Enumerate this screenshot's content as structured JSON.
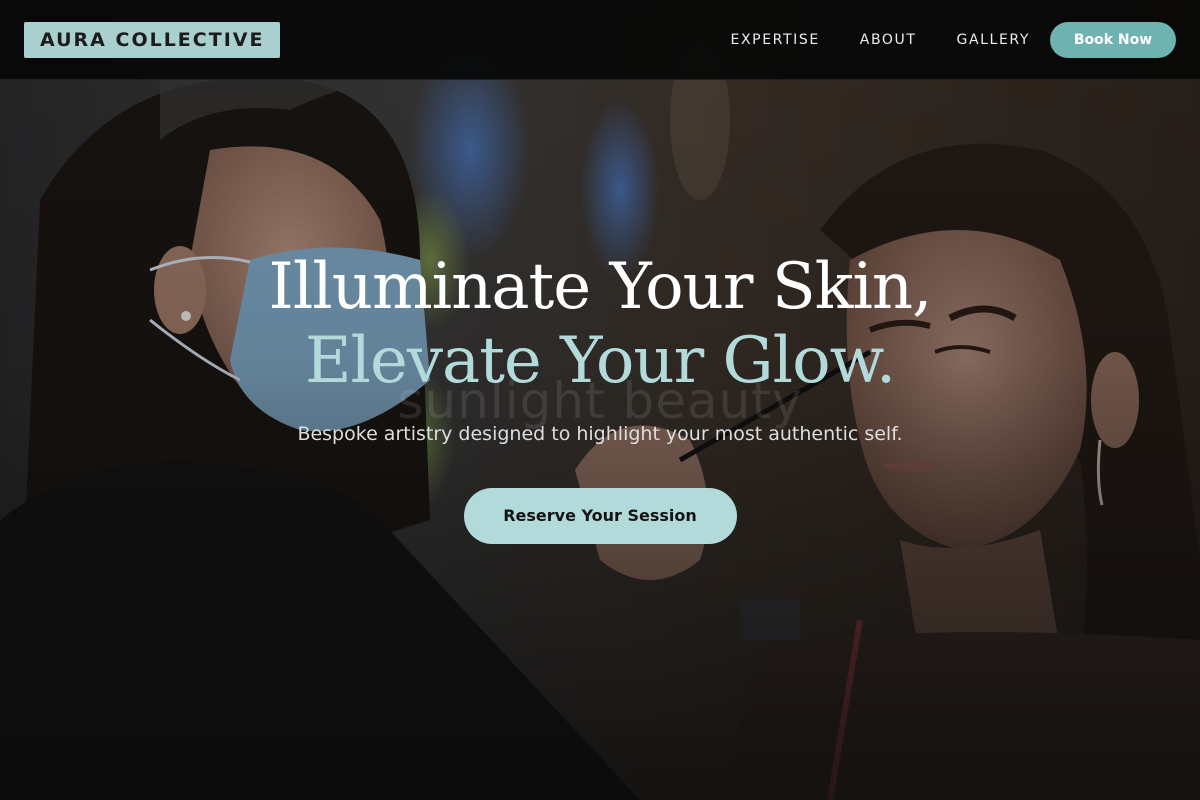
{
  "nav": {
    "logo": "AURA COLLECTIVE",
    "links": [
      "EXPERTISE",
      "ABOUT",
      "GALLERY"
    ],
    "book_label": "Book Now"
  },
  "hero": {
    "headline_line1": "Illuminate Your Skin,",
    "headline_line2": "Elevate Your Glow.",
    "watermark": "sunlight beauty",
    "subtitle": "Bespoke artistry designed to highlight your most authentic self.",
    "cta_label": "Reserve Your Session",
    "image_alt": "makeup-artist-applying-eyeliner-photo"
  },
  "colors": {
    "accent": "#b3dada",
    "accent_dark": "#6fb3b1",
    "logo_bg": "#a9cfce",
    "nav_bg": "#080808"
  }
}
